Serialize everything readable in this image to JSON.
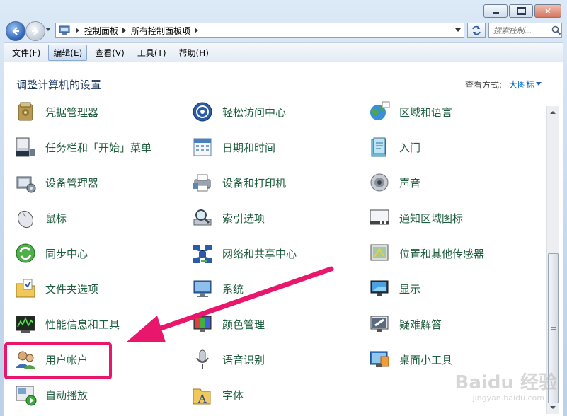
{
  "window": {
    "caption_min": "minimize",
    "caption_max": "maximize",
    "caption_close": "✕"
  },
  "address": {
    "crumbs": [
      "控制面板",
      "所有控制面板项"
    ]
  },
  "search": {
    "placeholder": "搜索控制..."
  },
  "menu": [
    "文件(F)",
    "编辑(E)",
    "查看(V)",
    "工具(T)",
    "帮助(H)"
  ],
  "heading": "调整计算机的设置",
  "view_by_label": "查看方式:",
  "view_by_value": "大图标",
  "items": [
    {
      "label": "凭据管理器",
      "icon": "vault-icon"
    },
    {
      "label": "轻松访问中心",
      "icon": "ease-of-access-icon"
    },
    {
      "label": "区域和语言",
      "icon": "globe-icon"
    },
    {
      "label": "任务栏和「开始」菜单",
      "icon": "taskbar-icon"
    },
    {
      "label": "日期和时间",
      "icon": "calendar-icon"
    },
    {
      "label": "入门",
      "icon": "getting-started-icon"
    },
    {
      "label": "设备管理器",
      "icon": "device-manager-icon"
    },
    {
      "label": "设备和打印机",
      "icon": "printer-icon"
    },
    {
      "label": "声音",
      "icon": "speaker-icon"
    },
    {
      "label": "鼠标",
      "icon": "mouse-icon"
    },
    {
      "label": "索引选项",
      "icon": "indexing-icon"
    },
    {
      "label": "通知区域图标",
      "icon": "notification-icon"
    },
    {
      "label": "同步中心",
      "icon": "sync-icon"
    },
    {
      "label": "网络和共享中心",
      "icon": "network-icon"
    },
    {
      "label": "位置和其他传感器",
      "icon": "sensor-icon"
    },
    {
      "label": "文件夹选项",
      "icon": "folder-options-icon"
    },
    {
      "label": "系统",
      "icon": "system-icon"
    },
    {
      "label": "显示",
      "icon": "display-icon"
    },
    {
      "label": "性能信息和工具",
      "icon": "performance-icon"
    },
    {
      "label": "颜色管理",
      "icon": "color-management-icon"
    },
    {
      "label": "疑难解答",
      "icon": "troubleshooting-icon"
    },
    {
      "label": "用户帐户",
      "icon": "user-accounts-icon"
    },
    {
      "label": "语音识别",
      "icon": "microphone-icon"
    },
    {
      "label": "桌面小工具",
      "icon": "gadgets-icon"
    },
    {
      "label": "自动播放",
      "icon": "autoplay-icon"
    },
    {
      "label": "字体",
      "icon": "fonts-icon"
    }
  ],
  "colors": {
    "highlight": "#e8176c",
    "link_green": "#1e5e3e",
    "heading_blue": "#1e395b"
  },
  "watermark": {
    "brand": "Baidu 经验",
    "url": "jingyan.baidu.com"
  }
}
